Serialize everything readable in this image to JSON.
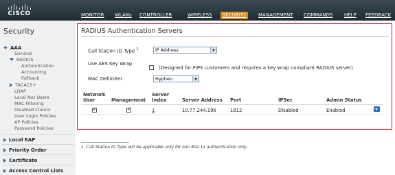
{
  "brand": {
    "logo_text": "CISCO"
  },
  "nav": {
    "items": [
      {
        "label": "MONITOR",
        "active": false
      },
      {
        "label": "WLANs",
        "active": false
      },
      {
        "label": "CONTROLLER",
        "active": false
      },
      {
        "label": "WIRELESS",
        "active": false
      },
      {
        "label": "SECURITY",
        "active": true
      },
      {
        "label": "MANAGEMENT",
        "active": false
      },
      {
        "label": "COMMANDS",
        "active": false
      },
      {
        "label": "HELP",
        "active": false
      },
      {
        "label": "FEEDBACK",
        "active": false
      }
    ]
  },
  "sidebar": {
    "title": "Security",
    "aaa": "AAA",
    "general": "General",
    "radius": "RADIUS",
    "authentication": "Authentication",
    "accounting": "Accounting",
    "fallback": "Fallback",
    "tacacs": "TACACS+",
    "ldap": "LDAP",
    "local_net_users": "Local Net Users",
    "mac_filtering": "MAC Filtering",
    "disabled_clients": "Disabled Clients",
    "user_login_policies": "User Login Policies",
    "ap_policies": "AP Policies",
    "password_policies": "Password Policies",
    "local_eap": "Local EAP",
    "priority_order": "Priority Order",
    "certificate": "Certificate",
    "access_control_lists": "Access Control Lists"
  },
  "main": {
    "title": "RADIUS Authentication Servers",
    "call_station_label": "Call Station ID Type",
    "call_station_marker": "1",
    "call_station_value": "IP Address",
    "aes_label": "Use AES Key Wrap",
    "aes_checked": false,
    "aes_note": "(Designed for FIPS customers and requires a key wrap compliant RADIUS server)",
    "mac_delim_label": "MAC Delimiter",
    "mac_delim_value": "Hyphen"
  },
  "table": {
    "headers": {
      "network_user": "Network\nUser",
      "management": "Management",
      "server_index": "Server\nIndex",
      "server_address": "Server Address",
      "port": "Port",
      "ipsec": "IPSec",
      "admin_status": "Admin Status"
    },
    "rows": [
      {
        "network_user": true,
        "management": true,
        "server_index": "1",
        "server_address": "10.77.244.196",
        "port": "1812",
        "ipsec": "Disabled",
        "admin_status": "Enabled"
      }
    ]
  },
  "footnote": "1. Call Station ID Type will be applicable only for non 802.1x authentication only.",
  "colors": {
    "header_bg": "#2a363c",
    "active_tab": "#d98c1a",
    "frame_border": "#d11d24",
    "sidebar_bg": "#eef0f1"
  }
}
